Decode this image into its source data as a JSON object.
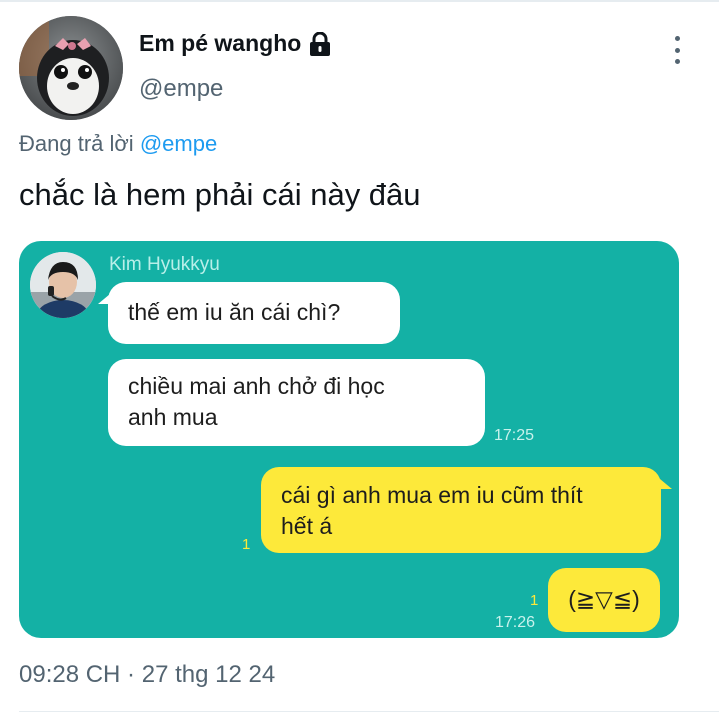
{
  "tweet": {
    "author": {
      "display_name": "Em pé wangho",
      "handle": "@empe"
    },
    "reply_prefix": "Đang trả lời",
    "reply_to": "@empe",
    "text": "chắc là hem phải cái này đâu",
    "timestamp": "09:28 CH · 27 thg 12 24"
  },
  "chat": {
    "sender_name": "Kim Hyukkyu",
    "messages": [
      {
        "side": "left",
        "lines": [
          "thế em iu ăn cái chì?"
        ]
      },
      {
        "side": "left",
        "lines": [
          "chiều mai anh chở đi học",
          "anh mua"
        ],
        "time": "17:25"
      },
      {
        "side": "right",
        "lines": [
          "cái gì anh mua em iu cũm thít",
          "hết á"
        ],
        "read": "1"
      },
      {
        "side": "right",
        "lines": [
          "(≧▽≦)"
        ],
        "read": "1",
        "time": "17:26"
      }
    ]
  },
  "colors": {
    "chat_background": "#14b1a5",
    "outgoing_bubble": "#fde93a",
    "incoming_bubble": "#ffffff",
    "mention": "#1d9bf0"
  },
  "icons": [
    "lock-icon",
    "more-options-icon"
  ]
}
